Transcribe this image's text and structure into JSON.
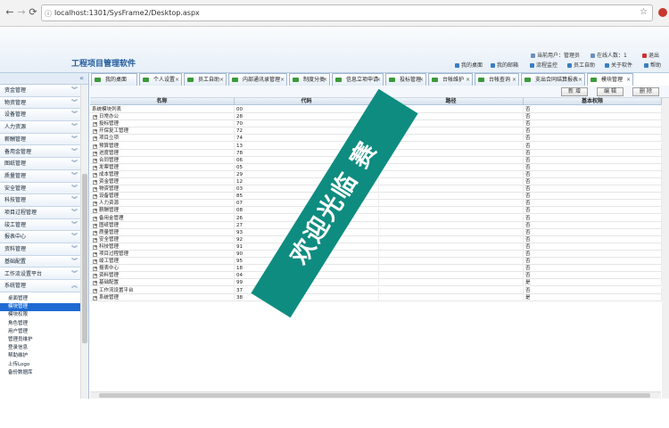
{
  "browser": {
    "url": "localhost:1301/SysFrame2/Desktop.aspx",
    "back_icon": "arrow-left-icon",
    "forward_icon": "arrow-right-icon",
    "reload_icon": "reload-icon"
  },
  "header": {
    "app_title": "工程项目管理软件",
    "current_user": "当前用户：管理员",
    "online_count": "在线人数：1",
    "exit": "退出",
    "links": [
      "我的桌面",
      "我的邮箱",
      "流程监控",
      "员工自助",
      "关于软件",
      "帮助"
    ]
  },
  "tabs": [
    {
      "label": "我的桌面",
      "closable": false
    },
    {
      "label": "个人设置",
      "closable": true
    },
    {
      "label": "员工自助",
      "closable": true
    },
    {
      "label": "内部通讯录管理",
      "closable": true
    },
    {
      "label": "制度分类",
      "closable": true
    },
    {
      "label": "信息立项申请",
      "closable": true
    },
    {
      "label": "投标管理",
      "closable": true
    },
    {
      "label": "台帐维护",
      "closable": true
    },
    {
      "label": "台帐查询",
      "closable": true
    },
    {
      "label": "支出合同结算报表",
      "closable": true
    },
    {
      "label": "模块管理",
      "closable": true
    }
  ],
  "sidebar": {
    "collapse_glyph": "«",
    "items": [
      "资金管理",
      "物资管理",
      "设备管理",
      "人力资源",
      "薪酬管理",
      "备用金管理",
      "图纸管理",
      "质量管理",
      "安全管理",
      "科技管理",
      "项目过程管理",
      "竣工管理",
      "报表中心",
      "资料管理",
      "基础配置",
      "工作流设置平台",
      "系统管理"
    ],
    "sub_items": [
      "桌面管理",
      "模块管理",
      "模块权限",
      "角色管理",
      "用户管理",
      "管理员维护",
      "登录信息",
      "帮助维护",
      "上传Logo",
      "备份数据库"
    ],
    "selected_sub": "模块管理"
  },
  "toolbar": {
    "new": "新 增",
    "edit": "编 辑",
    "delete": "删 除"
  },
  "table": {
    "headers": [
      "名称",
      "代码",
      "路径",
      "基本权限"
    ],
    "root": "系统模块列表",
    "rows": [
      {
        "name": "日常办公",
        "code": "28",
        "flag": "否"
      },
      {
        "name": "投标管理",
        "code": "70",
        "flag": "否"
      },
      {
        "name": "开保复工管理",
        "code": "72",
        "flag": "否"
      },
      {
        "name": "项目立项",
        "code": "74",
        "flag": "否"
      },
      {
        "name": "预算管理",
        "code": "13",
        "flag": "否"
      },
      {
        "name": "进度管理",
        "code": "78",
        "flag": "否"
      },
      {
        "name": "合同管理",
        "code": "06",
        "flag": "否"
      },
      {
        "name": "发票管理",
        "code": "05",
        "flag": "否"
      },
      {
        "name": "成本管理",
        "code": "29",
        "flag": "否"
      },
      {
        "name": "资金管理",
        "code": "12",
        "flag": "否"
      },
      {
        "name": "物资管理",
        "code": "03",
        "flag": "否"
      },
      {
        "name": "设备管理",
        "code": "85",
        "flag": "否"
      },
      {
        "name": "人力资源",
        "code": "07",
        "flag": "否"
      },
      {
        "name": "薪酬管理",
        "code": "08",
        "flag": "否"
      },
      {
        "name": "备用金管理",
        "code": "26",
        "flag": "否"
      },
      {
        "name": "图纸管理",
        "code": "27",
        "flag": "否"
      },
      {
        "name": "质量管理",
        "code": "93",
        "flag": "否"
      },
      {
        "name": "安全管理",
        "code": "92",
        "flag": "否"
      },
      {
        "name": "科技管理",
        "code": "91",
        "flag": "否"
      },
      {
        "name": "项目过程管理",
        "code": "90",
        "flag": "否"
      },
      {
        "name": "竣工管理",
        "code": "95",
        "flag": "否"
      },
      {
        "name": "报表中心",
        "code": "18",
        "flag": "否"
      },
      {
        "name": "资料管理",
        "code": "04",
        "flag": "否"
      },
      {
        "name": "基础配置",
        "code": "99",
        "flag": "是"
      },
      {
        "name": "工作流设置平台",
        "code": "37",
        "flag": "否"
      },
      {
        "name": "系统管理",
        "code": "38",
        "flag": "是"
      }
    ]
  },
  "root_code": "00",
  "root_flag": "否",
  "banner": "欢迎光临 赛",
  "colors": {
    "banner": "#0f8c80",
    "selection": "#1e6ad2",
    "title": "#1d5a9c"
  }
}
